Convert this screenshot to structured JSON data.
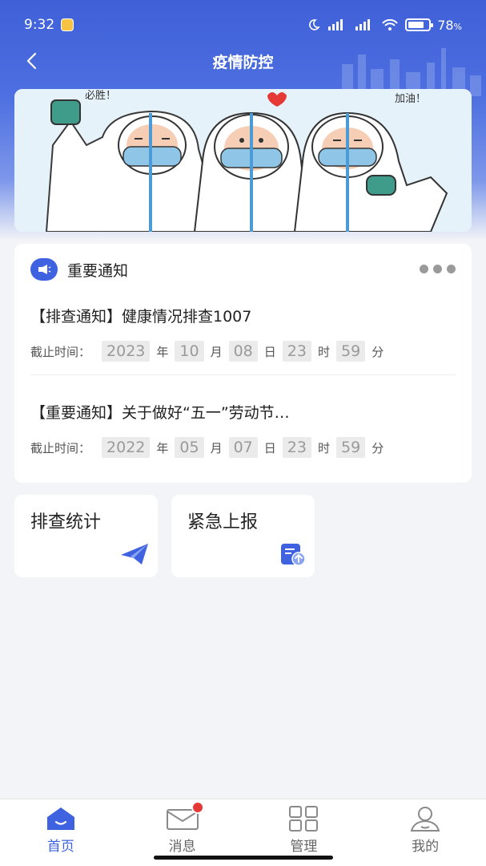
{
  "status_bar": {
    "time": "9:32",
    "battery_pct": "78",
    "battery_suffix": "%",
    "battery_level": 0.78
  },
  "nav": {
    "title": "疫情防控"
  },
  "banner": {
    "text_left": "必胜！",
    "text_right": "加油！"
  },
  "notice": {
    "heading": "重要通知",
    "items": [
      {
        "title": "【排查通知】健康情况排查1007",
        "deadline_label": "截止时间：",
        "year": "2023",
        "month": "10",
        "day": "08",
        "hour": "23",
        "minute": "59"
      },
      {
        "title": "【重要通知】关于做好“五一”劳动节…",
        "deadline_label": "截止时间：",
        "year": "2022",
        "month": "05",
        "day": "07",
        "hour": "23",
        "minute": "59"
      }
    ],
    "units": {
      "year": "年",
      "month": "月",
      "day": "日",
      "hour": "时",
      "minute": "分"
    }
  },
  "quick_actions": [
    {
      "label": "排查统计",
      "icon": "paper-plane-icon"
    },
    {
      "label": "紧急上报",
      "icon": "file-upload-icon"
    }
  ],
  "tabs": [
    {
      "label": "首页",
      "icon": "home-icon",
      "active": true
    },
    {
      "label": "消息",
      "icon": "mail-icon",
      "has_badge": true
    },
    {
      "label": "管理",
      "icon": "grid-icon"
    },
    {
      "label": "我的",
      "icon": "user-icon"
    }
  ],
  "colors": {
    "primary": "#3f63e0",
    "badge": "#e53935",
    "background": "#f3f4f8"
  }
}
